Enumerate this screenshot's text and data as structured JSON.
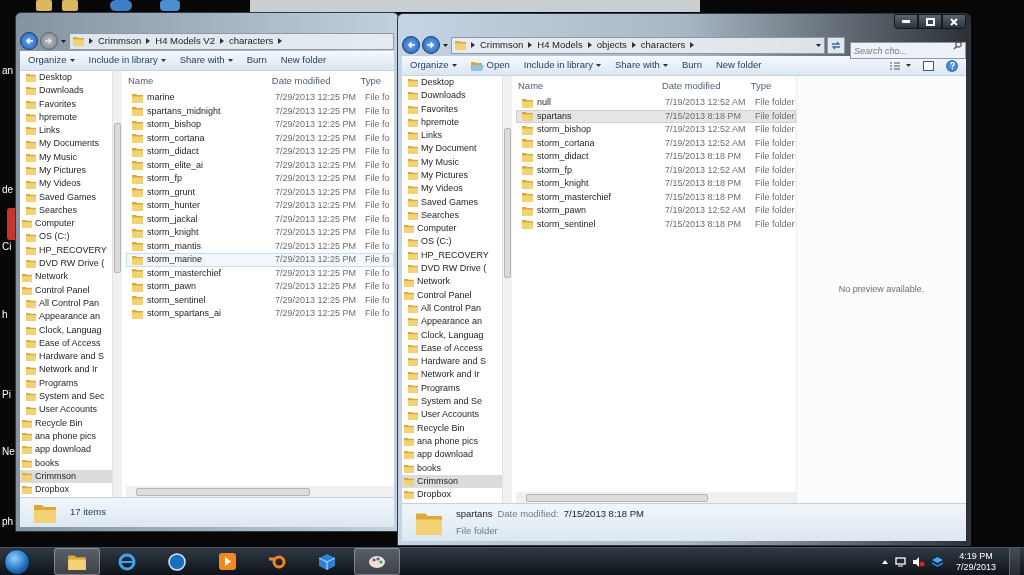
{
  "desktop_labels": [
    "an",
    "de",
    "Ci",
    "h",
    "Pi",
    "Ne",
    "ph"
  ],
  "windows": [
    {
      "nav_buttons": [
        {
          "kind": "back",
          "disabled": false
        },
        {
          "kind": "forward",
          "disabled": true
        }
      ],
      "breadcrumb": [
        "Crimmson",
        "H4 Models V2",
        "characters"
      ],
      "toolbar": [
        {
          "label": "Organize",
          "kind": "menu"
        },
        {
          "label": "Include in library",
          "kind": "menu"
        },
        {
          "label": "Share with",
          "kind": "menu"
        },
        {
          "label": "Burn",
          "kind": "plain"
        },
        {
          "label": "New folder",
          "kind": "plain"
        }
      ],
      "nav": [
        {
          "children": [
            {
              "label": "Desktop",
              "selected": false
            },
            {
              "label": "Downloads",
              "selected": false
            },
            {
              "label": "Favorites",
              "selected": false
            },
            {
              "label": "hpremote",
              "selected": false
            },
            {
              "label": "Links",
              "selected": false
            },
            {
              "label": "My Documents",
              "selected": false
            },
            {
              "label": "My Music",
              "selected": false
            },
            {
              "label": "My Pictures",
              "selected": false
            },
            {
              "label": "My Videos",
              "selected": false
            },
            {
              "label": "Saved Games",
              "selected": false
            },
            {
              "label": "Searches",
              "selected": false
            }
          ]
        },
        {
          "label": "Computer",
          "selected": false,
          "children": [
            {
              "label": "OS (C:)",
              "selected": false
            },
            {
              "label": "HP_RECOVERY",
              "selected": false
            },
            {
              "label": "DVD RW Drive (",
              "selected": false
            }
          ]
        },
        {
          "label": "Network",
          "selected": false
        },
        {
          "label": "Control Panel",
          "selected": false,
          "children": [
            {
              "label": "All Control Pan",
              "selected": false
            },
            {
              "label": "Appearance an",
              "selected": false
            },
            {
              "label": "Clock, Languag",
              "selected": false
            },
            {
              "label": "Ease of Access",
              "selected": false
            },
            {
              "label": "Hardware and S",
              "selected": false
            },
            {
              "label": "Network and Ir",
              "selected": false
            },
            {
              "label": "Programs",
              "selected": false
            },
            {
              "label": "System and Sec",
              "selected": false
            },
            {
              "label": "User Accounts",
              "selected": false
            }
          ]
        },
        {
          "label": "Recycle Bin",
          "selected": false
        },
        {
          "label": "ana phone pics",
          "selected": false
        },
        {
          "label": "app download",
          "selected": false
        },
        {
          "label": "books",
          "selected": false
        },
        {
          "label": "Crimmson",
          "selected": true
        },
        {
          "label": "Dropbox",
          "selected": false
        }
      ],
      "columns": [
        "Name",
        "Date modified",
        "Type"
      ],
      "rows": [
        {
          "name": "marine",
          "date": "7/29/2013 12:25 PM",
          "type": "File fo",
          "selected": false,
          "hovered": false
        },
        {
          "name": "spartans_midnight",
          "date": "7/29/2013 12:25 PM",
          "type": "File fo",
          "selected": false,
          "hovered": false
        },
        {
          "name": "storm_bishop",
          "date": "7/29/2013 12:25 PM",
          "type": "File fo",
          "selected": false,
          "hovered": false
        },
        {
          "name": "storm_cortana",
          "date": "7/29/2013 12:25 PM",
          "type": "File fo",
          "selected": false,
          "hovered": false
        },
        {
          "name": "storm_didact",
          "date": "7/29/2013 12:25 PM",
          "type": "File fo",
          "selected": false,
          "hovered": false
        },
        {
          "name": "storm_elite_ai",
          "date": "7/29/2013 12:25 PM",
          "type": "File fo",
          "selected": false,
          "hovered": false
        },
        {
          "name": "storm_fp",
          "date": "7/29/2013 12:25 PM",
          "type": "File fo",
          "selected": false,
          "hovered": false
        },
        {
          "name": "storm_grunt",
          "date": "7/29/2013 12:25 PM",
          "type": "File fo",
          "selected": false,
          "hovered": false
        },
        {
          "name": "storm_hunter",
          "date": "7/29/2013 12:25 PM",
          "type": "File fo",
          "selected": false,
          "hovered": false
        },
        {
          "name": "storm_jackal",
          "date": "7/29/2013 12:25 PM",
          "type": "File fo",
          "selected": false,
          "hovered": false
        },
        {
          "name": "storm_knight",
          "date": "7/29/2013 12:25 PM",
          "type": "File fo",
          "selected": false,
          "hovered": false
        },
        {
          "name": "storm_mantis",
          "date": "7/29/2013 12:25 PM",
          "type": "File fo",
          "selected": false,
          "hovered": false
        },
        {
          "name": "storm_marine",
          "date": "7/29/2013 12:25 PM",
          "type": "File fo",
          "selected": false,
          "hovered": true
        },
        {
          "name": "storm_masterchief",
          "date": "7/29/2013 12:25 PM",
          "type": "File fo",
          "selected": false,
          "hovered": false
        },
        {
          "name": "storm_pawn",
          "date": "7/29/2013 12:25 PM",
          "type": "File fo",
          "selected": false,
          "hovered": false
        },
        {
          "name": "storm_sentinel",
          "date": "7/29/2013 12:25 PM",
          "type": "File fo",
          "selected": false,
          "hovered": false
        },
        {
          "name": "storm_spartans_ai",
          "date": "7/29/2013 12:25 PM",
          "type": "File fo",
          "selected": false,
          "hovered": false
        }
      ],
      "details": {
        "kind": "count",
        "text": "17 items"
      }
    },
    {
      "window_controls": [
        {
          "kind": "minimize"
        },
        {
          "kind": "maximize"
        },
        {
          "kind": "close"
        }
      ],
      "nav_buttons": [
        {
          "kind": "back",
          "disabled": false
        },
        {
          "kind": "forward",
          "disabled": false
        }
      ],
      "breadcrumb": [
        "Crimmson",
        "H4 Models",
        "objects",
        "characters"
      ],
      "search": {
        "placeholder": "Search cho..."
      },
      "toolbar": [
        {
          "label": "Organize",
          "kind": "menu"
        },
        {
          "label": "Open",
          "kind": "iconic"
        },
        {
          "label": "Include in library",
          "kind": "menu"
        },
        {
          "label": "Share with",
          "kind": "menu"
        },
        {
          "label": "Burn",
          "kind": "plain"
        },
        {
          "label": "New folder",
          "kind": "plain"
        }
      ],
      "tools": [
        {
          "kind": "views"
        },
        {
          "kind": "preview-pane"
        },
        {
          "kind": "help"
        }
      ],
      "nav": [
        {
          "children": [
            {
              "label": "Desktop",
              "selected": false
            },
            {
              "label": "Downloads",
              "selected": false
            },
            {
              "label": "Favorites",
              "selected": false
            },
            {
              "label": "hpremote",
              "selected": false
            },
            {
              "label": "Links",
              "selected": false
            },
            {
              "label": "My Document",
              "selected": false
            },
            {
              "label": "My Music",
              "selected": false
            },
            {
              "label": "My Pictures",
              "selected": false
            },
            {
              "label": "My Videos",
              "selected": false
            },
            {
              "label": "Saved Games",
              "selected": false
            },
            {
              "label": "Searches",
              "selected": false
            }
          ]
        },
        {
          "label": "Computer",
          "selected": false,
          "children": [
            {
              "label": "OS (C:)",
              "selected": false
            },
            {
              "label": "HP_RECOVERY",
              "selected": false
            },
            {
              "label": "DVD RW Drive (",
              "selected": false
            }
          ]
        },
        {
          "label": "Network",
          "selected": false
        },
        {
          "label": "Control Panel",
          "selected": false,
          "children": [
            {
              "label": "All Control Pan",
              "selected": false
            },
            {
              "label": "Appearance an",
              "selected": false
            },
            {
              "label": "Clock, Languag",
              "selected": false
            },
            {
              "label": "Ease of Access",
              "selected": false
            },
            {
              "label": "Hardware and S",
              "selected": false
            },
            {
              "label": "Network and Ir",
              "selected": false
            },
            {
              "label": "Programs",
              "selected": false
            },
            {
              "label": "System and Se",
              "selected": false
            },
            {
              "label": "User Accounts",
              "selected": false
            }
          ]
        },
        {
          "label": "Recycle Bin",
          "selected": false
        },
        {
          "label": "ana phone pics",
          "selected": false
        },
        {
          "label": "app download",
          "selected": false
        },
        {
          "label": "books",
          "selected": false
        },
        {
          "label": "Crimmson",
          "selected": true
        },
        {
          "label": "Dropbox",
          "selected": false
        }
      ],
      "columns": [
        "Name",
        "Date modified",
        "Type"
      ],
      "rows": [
        {
          "name": "null",
          "date": "7/19/2013 12:52 AM",
          "type": "File folder",
          "selected": false,
          "hovered": false
        },
        {
          "name": "spartans",
          "date": "7/15/2013 8:18 PM",
          "type": "File folder",
          "selected": true,
          "hovered": false
        },
        {
          "name": "storm_bishop",
          "date": "7/19/2013 12:52 AM",
          "type": "File folder",
          "selected": false,
          "hovered": false
        },
        {
          "name": "storm_cortana",
          "date": "7/19/2013 12:52 AM",
          "type": "File folder",
          "selected": false,
          "hovered": false
        },
        {
          "name": "storm_didact",
          "date": "7/15/2013 8:18 PM",
          "type": "File folder",
          "selected": false,
          "hovered": false
        },
        {
          "name": "storm_fp",
          "date": "7/19/2013 12:52 AM",
          "type": "File folder",
          "selected": false,
          "hovered": false
        },
        {
          "name": "storm_knight",
          "date": "7/15/2013 8:18 PM",
          "type": "File folder",
          "selected": false,
          "hovered": false
        },
        {
          "name": "storm_masterchief",
          "date": "7/15/2013 8:18 PM",
          "type": "File folder",
          "selected": false,
          "hovered": false
        },
        {
          "name": "storm_pawn",
          "date": "7/19/2013 12:52 AM",
          "type": "File folder",
          "selected": false,
          "hovered": false
        },
        {
          "name": "storm_sentinel",
          "date": "7/15/2013 8:18 PM",
          "type": "File folder",
          "selected": false,
          "hovered": false
        }
      ],
      "preview": {
        "text": "No preview available."
      },
      "details": {
        "kind": "item",
        "name": "spartans",
        "date_label": "Date modified:",
        "date": "7/15/2013 8:18 PM",
        "type": "File folder"
      }
    }
  ],
  "taskbar": {
    "apps": [
      {
        "kind": "explorer",
        "active": true
      },
      {
        "kind": "browser",
        "active": false
      },
      {
        "kind": "hp",
        "active": false
      },
      {
        "kind": "media",
        "active": false
      },
      {
        "kind": "blender",
        "active": false
      },
      {
        "kind": "box",
        "active": false
      },
      {
        "kind": "paint",
        "active": true
      }
    ],
    "clock": {
      "time": "4:19 PM",
      "date": "7/29/2013"
    }
  }
}
